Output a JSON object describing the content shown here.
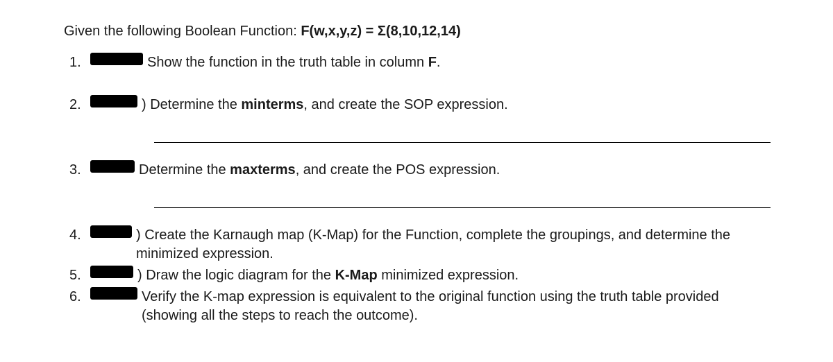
{
  "intro_prefix": "Given the following Boolean Function: ",
  "intro_formula": "F(w,x,y,z) = Σ(8,10,12,14)",
  "items": [
    {
      "num": "1.",
      "text_before": "Show the function in the truth table in column ",
      "bold_token": "F",
      "text_after": "."
    },
    {
      "num": "2.",
      "prefix": ") Determine the ",
      "bold_token": "minterms",
      "text_after": ", and create the SOP expression."
    },
    {
      "num": "3.",
      "prefix": " Determine the ",
      "bold_token": "maxterms",
      "text_after": ", and create the POS expression."
    },
    {
      "num": "4.",
      "text": ") Create the Karnaugh map (K-Map) for the Function, complete the groupings, and determine the minimized expression."
    },
    {
      "num": "5.",
      "prefix": ") Draw the logic diagram for the ",
      "bold_token": "K-Map",
      "text_after": " minimized expression."
    },
    {
      "num": "6.",
      "text": " Verify the K-map expression is equivalent to the original function using the truth table provided (showing all the steps to reach the outcome)."
    }
  ]
}
